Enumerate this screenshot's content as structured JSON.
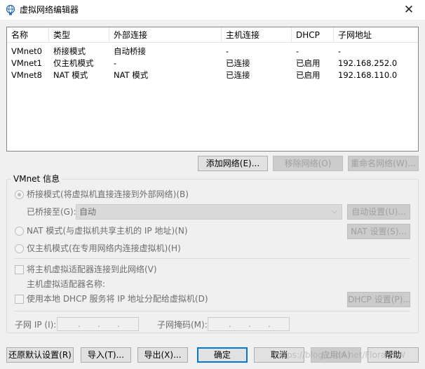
{
  "window": {
    "title": "虚拟网络编辑器"
  },
  "table": {
    "columns": [
      "名称",
      "类型",
      "外部连接",
      "主机连接",
      "DHCP",
      "子网地址"
    ],
    "rows": [
      [
        "VMnet0",
        "桥接模式",
        "自动桥接",
        "-",
        "-",
        "-"
      ],
      [
        "VMnet1",
        "仅主机模式",
        "-",
        "已连接",
        "已启用",
        "192.168.252.0"
      ],
      [
        "VMnet8",
        "NAT 模式",
        "NAT 模式",
        "已连接",
        "已启用",
        "192.168.110.0"
      ]
    ]
  },
  "list_buttons": {
    "add": "添加网络(E)...",
    "remove": "移除网络(O)",
    "rename": "重命名网络(W)..."
  },
  "vmnet_info": {
    "title": "VMnet 信息",
    "bridged_radio": "桥接模式(将虚拟机直接连接到外部网络)(B)",
    "bridged_to_label": "已桥接至(G):",
    "bridged_to_value": "自动",
    "auto_settings": "自动设置(U)...",
    "nat_radio": "NAT 模式(与虚拟机共享主机的 IP 地址)(N)",
    "nat_settings": "NAT 设置(S)...",
    "hostonly_radio": "仅主机模式(在专用网络内连接虚拟机)(H)",
    "connect_adapter_check": "将主机虚拟适配器连接到此网络(V)",
    "adapter_name_label": "主机虚拟适配器名称:",
    "dhcp_check": "使用本地 DHCP 服务将 IP 地址分配给虚拟机(D)",
    "dhcp_settings": "DHCP 设置(P)...",
    "subnet_ip_label": "子网 IP (I):",
    "subnet_mask_label": "子网掩码(M):",
    "ip_dot": "."
  },
  "bottom_buttons": {
    "restore": "还原默认设置(R)",
    "import": "导入(T)...",
    "export": "导出(X)...",
    "ok": "确定",
    "cancel": "取消",
    "apply": "应用(A)",
    "help": "帮助"
  },
  "watermark": "https://blog.csdn.net/FloraCSW",
  "icons": {
    "app": "network-globe-icon",
    "close": "close-icon",
    "dropdown": "chevron-down-icon"
  },
  "colors": {
    "accent": "#0078d7",
    "disabled_text": "#a0a0a0"
  }
}
